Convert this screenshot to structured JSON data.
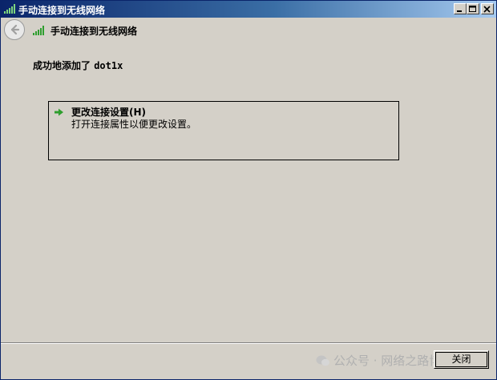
{
  "window": {
    "title": "手动连接到无线网络",
    "controls": {
      "minimize": "minimize",
      "maximize": "maximize",
      "close": "close"
    }
  },
  "header": {
    "title": "手动连接到无线网络",
    "back_icon": "back-arrow-icon",
    "signal_icon": "wireless-signal-icon"
  },
  "main": {
    "message_prefix": "成功地添加了 ",
    "network_name": "dot1x",
    "option": {
      "icon": "green-arrow-icon",
      "title": "更改连接设置(H)",
      "description": "打开连接属性以便更改设置。"
    }
  },
  "footer": {
    "watermark": "公众号 · 网络之路博客",
    "close_label": "关闭"
  },
  "colors": {
    "titlebar_start": "#0a246a",
    "titlebar_end": "#a6caf0",
    "background": "#d4d0c8",
    "arrow_green": "#2e9e2e"
  }
}
